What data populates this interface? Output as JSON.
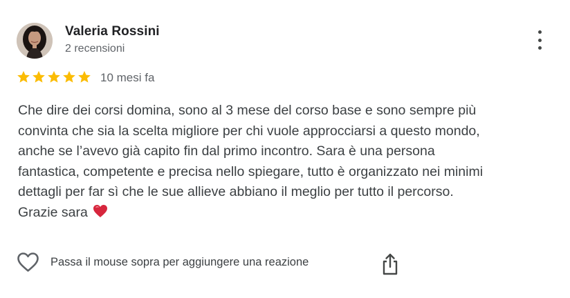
{
  "reviewer": {
    "name": "Valeria Rossini",
    "review_count": "2 recensioni"
  },
  "rating": {
    "stars": 5,
    "max": 5,
    "star_color": "#fbbc04",
    "time_ago": "10 mesi fa"
  },
  "review": {
    "lines": [
      "Che dire dei corsi domina, sono al 3 mese del corso base e sono sempre più",
      "convinta che sia la scelta migliore per chi vuole approcciarsi a questo mondo,",
      "anche se l’avevo già capito fin dal primo incontro. Sara è una persona",
      "fantastica, competente e precisa nello spiegare, tutto è organizzato nei minimi",
      "dettagli per far sì che le sue allieve abbiano il meglio per tutto il percorso.",
      "Grazie sara"
    ],
    "trailing_emoji": "red-heart"
  },
  "actions": {
    "reaction_label": "Passa il mouse sopra per aggiungere una reazione",
    "reaction_icon": "heart-outline-icon",
    "share_icon": "share-icon",
    "more_icon": "more-vertical-icon"
  }
}
